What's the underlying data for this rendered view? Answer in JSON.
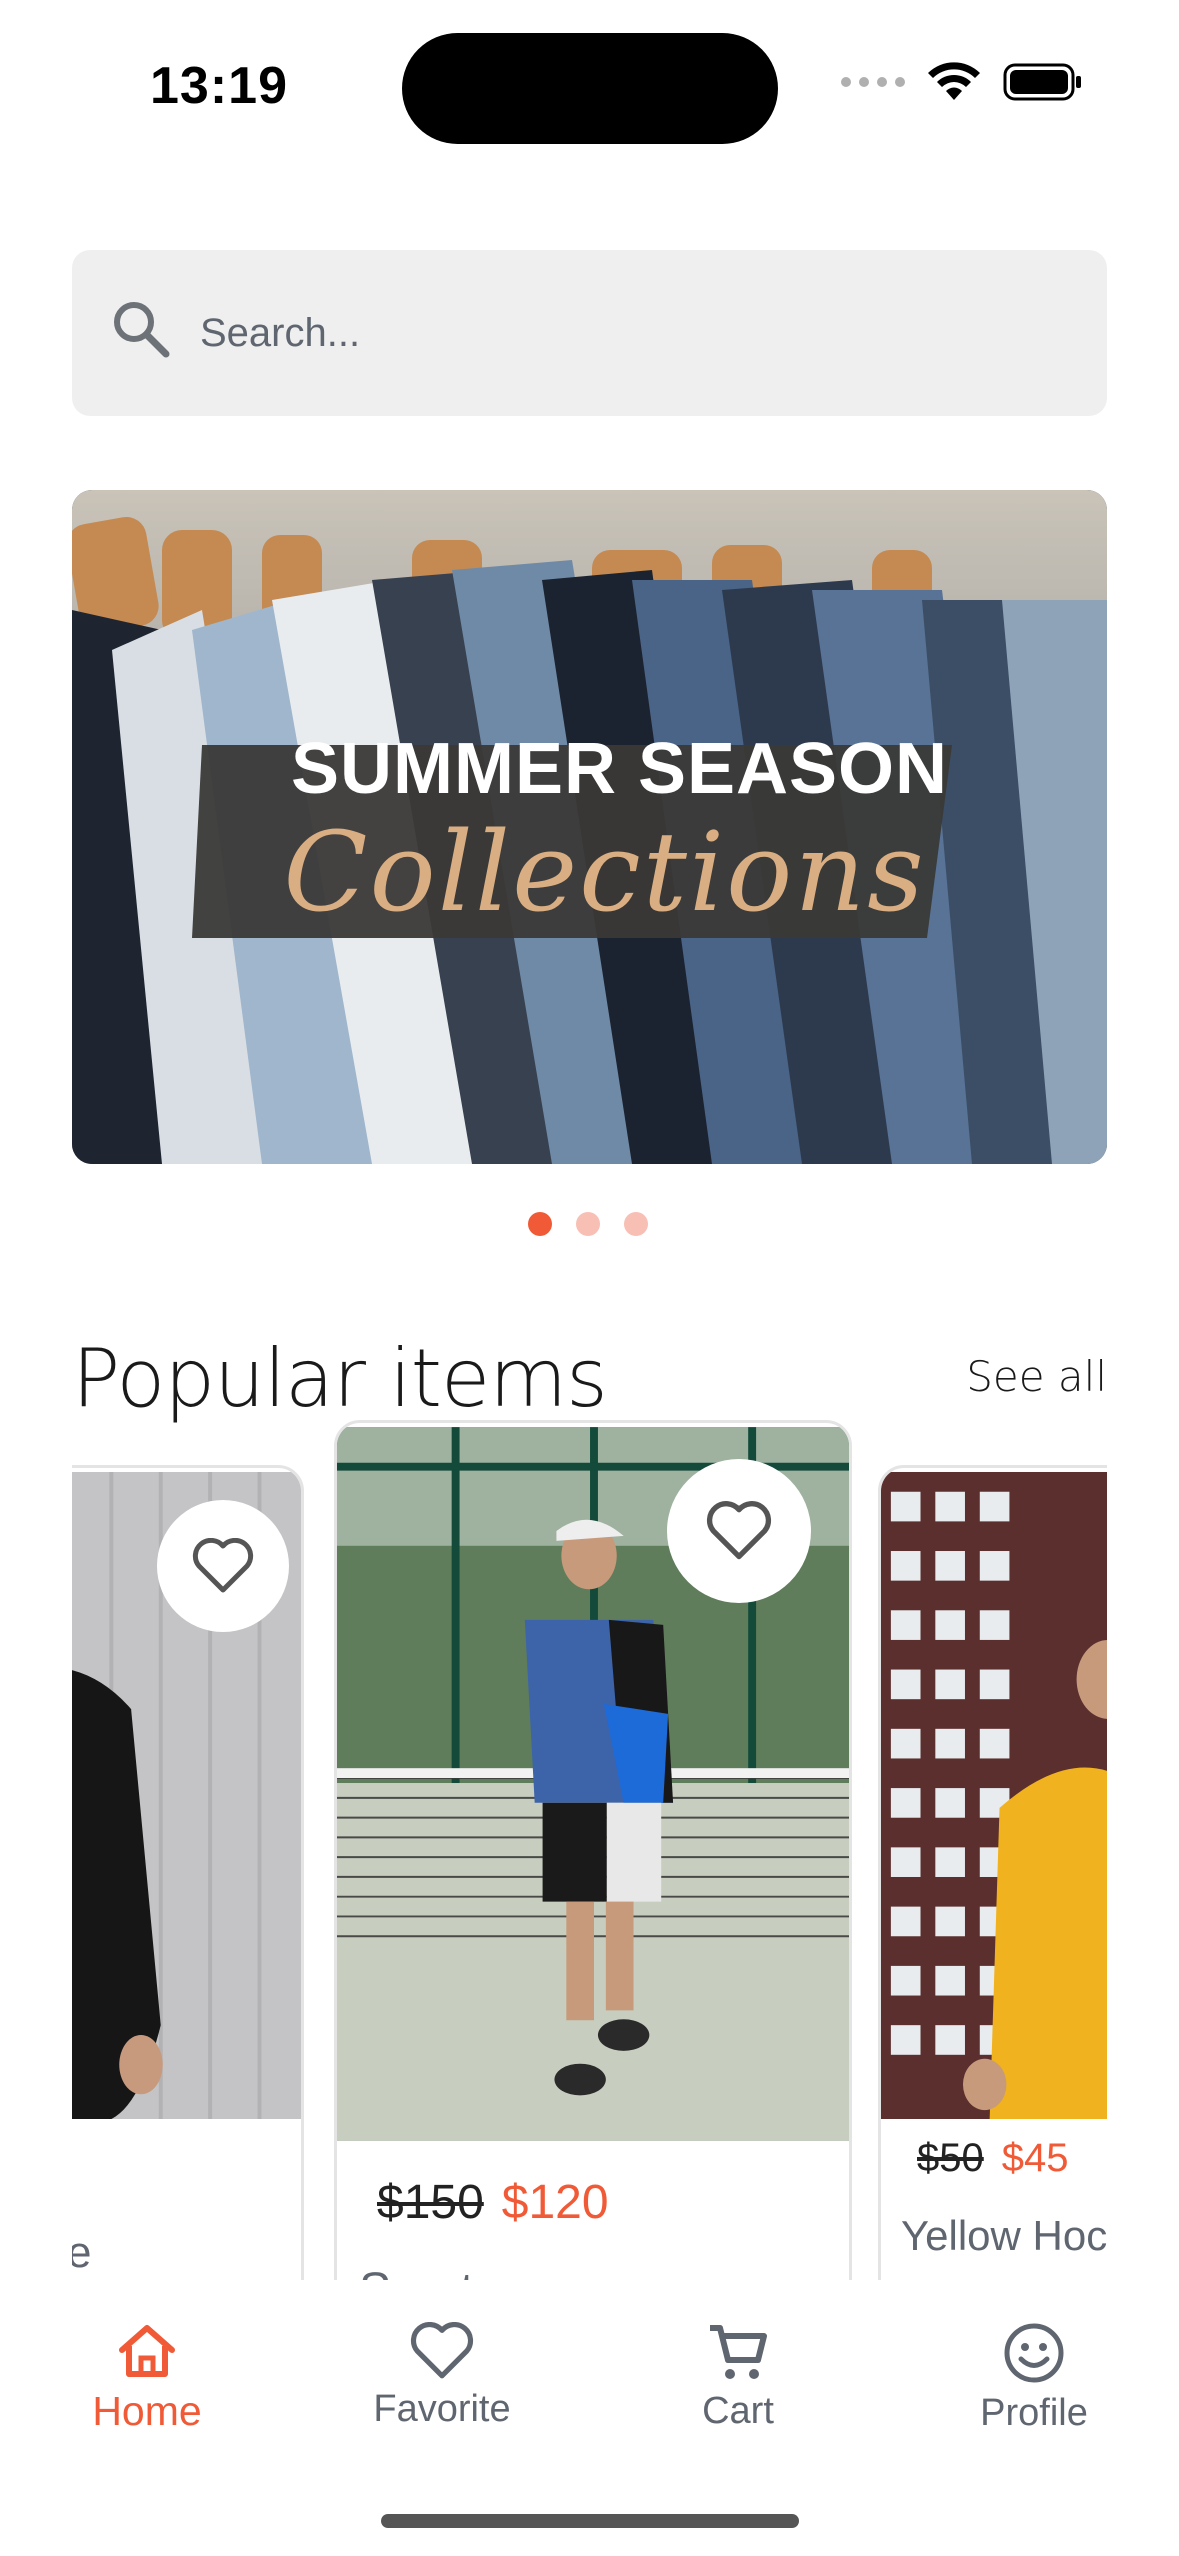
{
  "status_bar": {
    "time": "13:19",
    "icons": [
      "cellular-signal-icon",
      "wifi-icon",
      "battery-icon"
    ]
  },
  "search": {
    "placeholder": "Search...",
    "icon": "search-icon"
  },
  "banner": {
    "title": "SUMMER SEASON",
    "subtitle": "Collections",
    "slide_count": 3,
    "active_slide": 1
  },
  "section": {
    "title": "Popular items",
    "see_all_label": "See all"
  },
  "products": [
    {
      "name": "e",
      "old_price": "",
      "new_price": "",
      "favorite_icon": "heart-outline-icon"
    },
    {
      "name": "Sport",
      "old_price": "$150",
      "new_price": "$120",
      "favorite_icon": "heart-outline-icon"
    },
    {
      "name": "Yellow Hoc",
      "old_price": "$50",
      "new_price": "$45",
      "favorite_icon": ""
    }
  ],
  "tabs": [
    {
      "label": "Home",
      "icon": "home-icon",
      "active": true
    },
    {
      "label": "Favorite",
      "icon": "heart-icon",
      "active": false
    },
    {
      "label": "Cart",
      "icon": "cart-icon",
      "active": false
    },
    {
      "label": "Profile",
      "icon": "smiley-icon",
      "active": false
    }
  ],
  "colors": {
    "accent": "#f05a36",
    "dot_inactive": "#f8bfb5",
    "search_bg": "#efefef",
    "muted_text": "#5f6670"
  }
}
